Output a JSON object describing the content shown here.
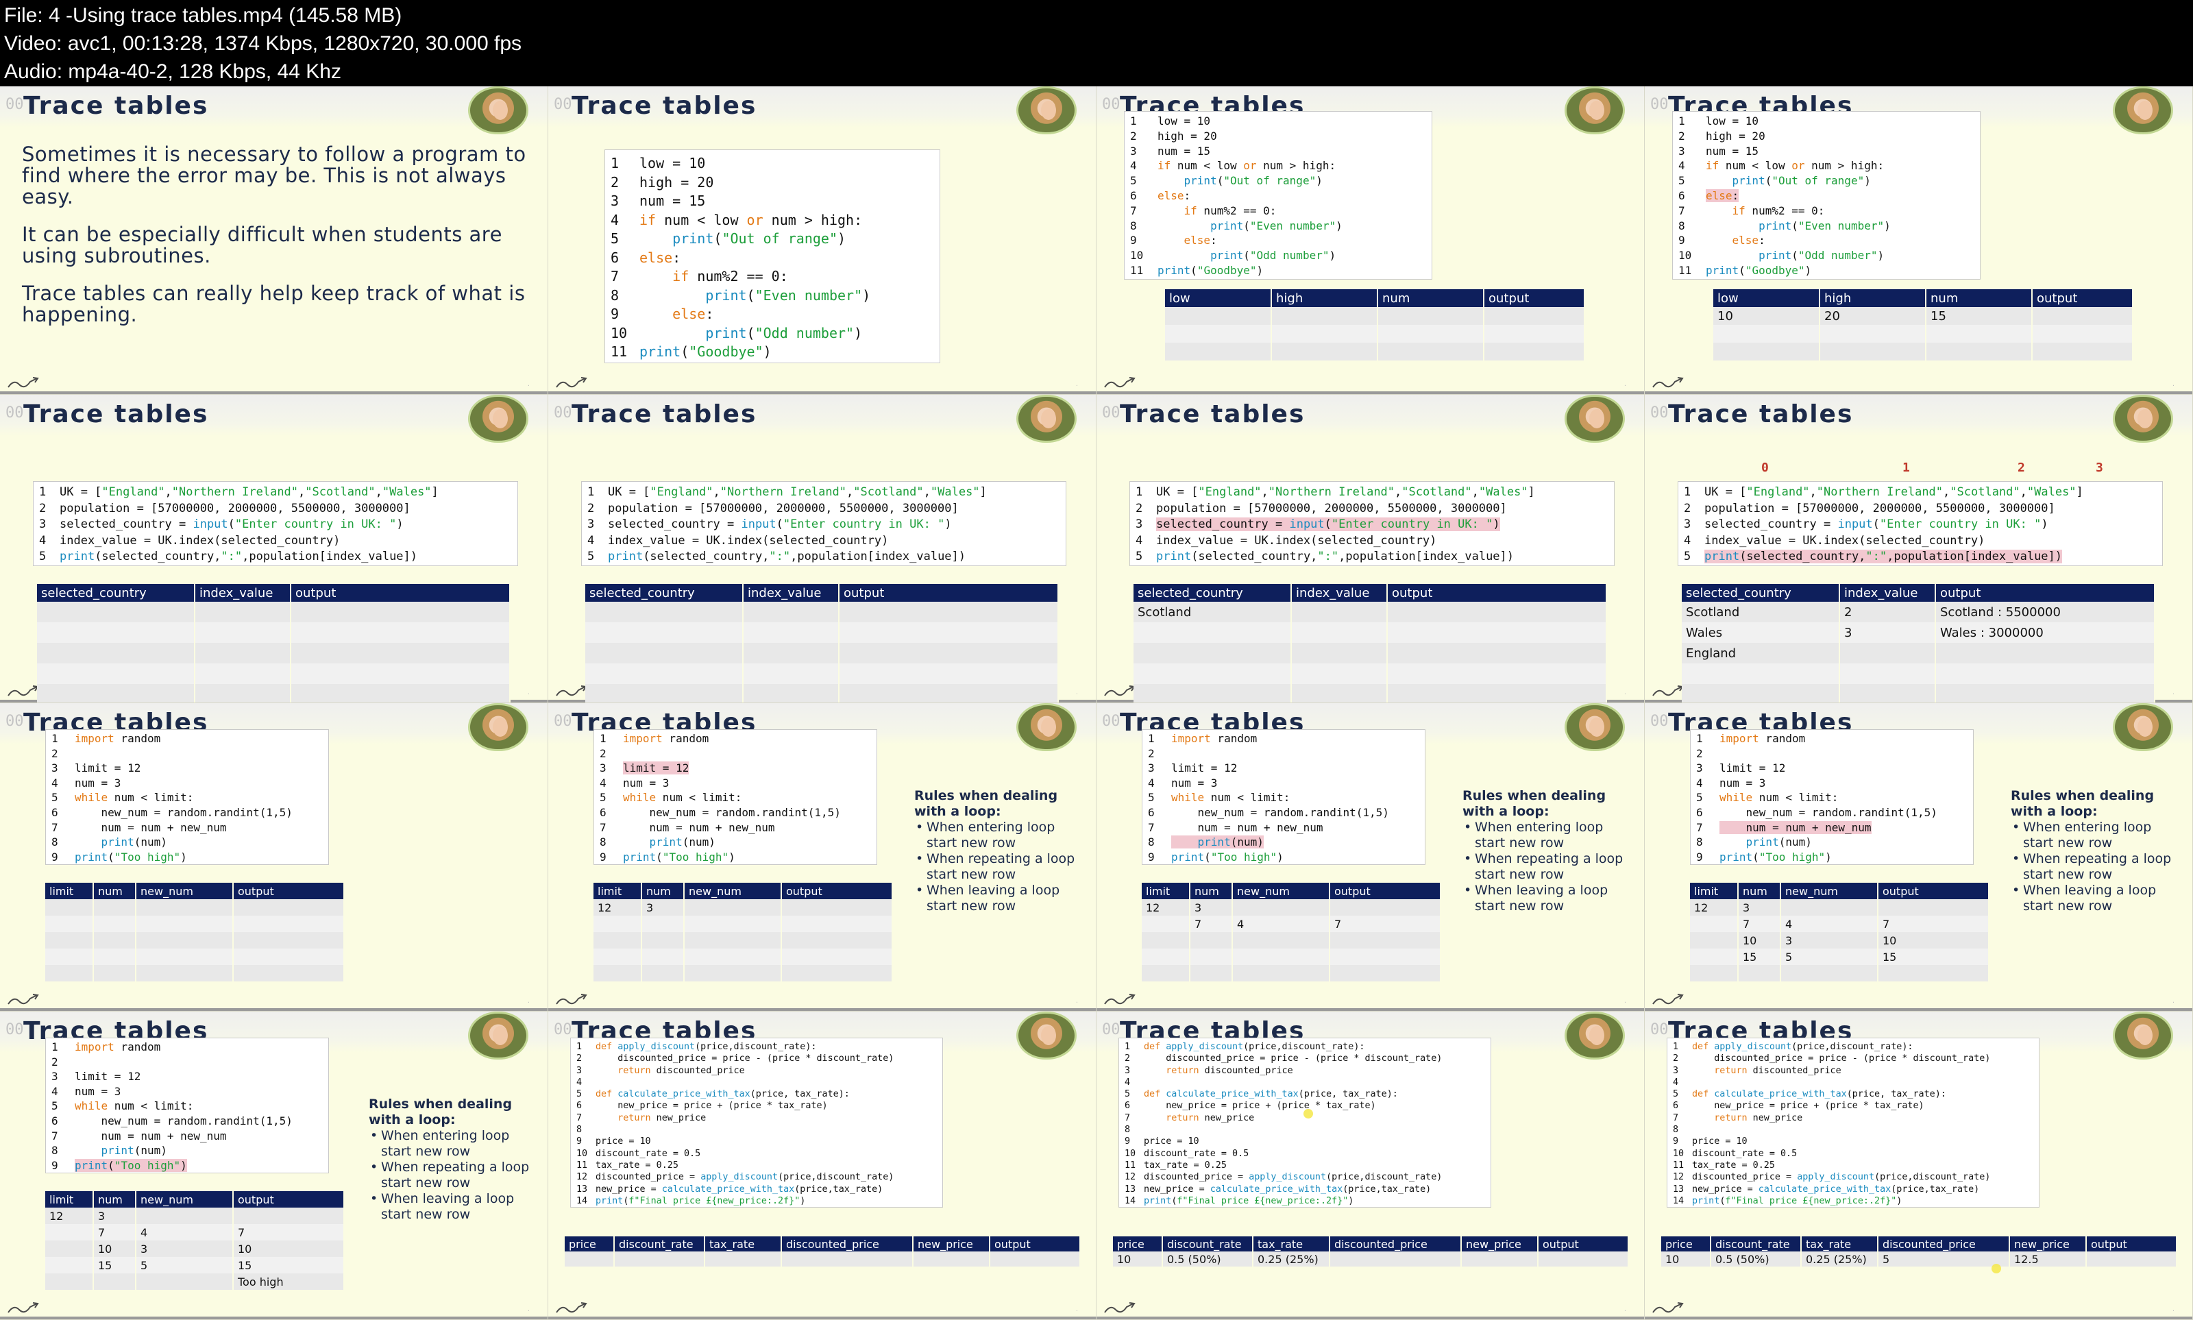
{
  "header": {
    "file_line": "File: 4 -Using trace tables.mp4 (145.58 MB)",
    "video_line": "Video: avc1, 00:13:28, 1374 Kbps, 1280x720, 30.000 fps",
    "audio_line": "Audio: mp4a-40-2, 128 Kbps, 44 Khz"
  },
  "slide_title": "Trace tables",
  "corner_timestamp": "00",
  "intro": {
    "p1": "Sometimes it is necessary to follow a program to find where the error may be. This is not always easy.",
    "p2": "It can be especially difficult when students are using subroutines.",
    "p3": "Trace tables can really help keep track of what is happening."
  },
  "code1": [
    "low = 10",
    "high = 20",
    "num = 15",
    "if num < low or num > high:",
    "    print(\"Out of range\")",
    "else:",
    "    if num%2 == 0:",
    "        print(\"Even number\")",
    "    else:",
    "        print(\"Odd number\")",
    "print(\"Goodbye\")"
  ],
  "table1": {
    "headers": [
      "low",
      "high",
      "num",
      "output"
    ],
    "filled_row": [
      "10",
      "20",
      "15",
      ""
    ]
  },
  "code2": [
    "UK = [\"England\",\"Northern Ireland\",\"Scotland\",\"Wales\"]",
    "population = [57000000, 2000000, 5500000, 3000000]",
    "selected_country = input(\"Enter country in UK: \")",
    "index_value = UK.index(selected_country)",
    "print(selected_country,\":\",population[index_value])"
  ],
  "table2": {
    "headers": [
      "selected_country",
      "index_value",
      "output"
    ],
    "partial_row": [
      "Scotland",
      "",
      ""
    ],
    "rows": [
      [
        "Scotland",
        "2",
        "Scotland : 5500000"
      ],
      [
        "Wales",
        "3",
        "Wales : 3000000"
      ],
      [
        "England",
        "",
        ""
      ]
    ]
  },
  "index_labels": [
    "0",
    "1",
    "2",
    "3"
  ],
  "code3": [
    "import random",
    "",
    "limit = 12",
    "num = 3",
    "while num < limit:",
    "    new_num = random.randint(1,5)",
    "    num = num + new_num",
    "    print(num)",
    "print(\"Too high\")"
  ],
  "table3": {
    "headers": [
      "limit",
      "num",
      "new_num",
      "output"
    ],
    "rows": [
      [
        "12",
        "3",
        "",
        ""
      ],
      [
        "",
        "7",
        "4",
        "7"
      ],
      [
        "",
        "10",
        "3",
        "10"
      ],
      [
        "",
        "15",
        "5",
        "15"
      ],
      [
        "",
        "",
        "",
        "Too high"
      ]
    ]
  },
  "rules": {
    "title": "Rules when dealing with a loop:",
    "items": [
      "When entering loop start new row",
      "When repeating a loop start new row",
      "When leaving a loop start new row"
    ]
  },
  "code4": [
    "def apply_discount(price,discount_rate):",
    "    discounted_price = price - (price * discount_rate)",
    "    return discounted_price",
    "",
    "def calculate_price_with_tax(price, tax_rate):",
    "    new_price = price + (price * tax_rate)",
    "    return new_price",
    "",
    "price = 10",
    "discount_rate = 0.5",
    "tax_rate = 0.25",
    "discounted_price = apply_discount(price,discount_rate)",
    "new_price = calculate_price_with_tax(price,tax_rate)",
    "print(f\"Final price £{new_price:.2f}\")"
  ],
  "table4": {
    "headers": [
      "price",
      "discount_rate",
      "tax_rate",
      "discounted_price",
      "new_price",
      "output"
    ],
    "row_a": [
      "10",
      "0.5 (50%)",
      "0.25 (25%)",
      "",
      "",
      ""
    ],
    "row_b": [
      "10",
      "0.5 (50%)",
      "0.25 (25%)",
      "5",
      "12.5",
      ""
    ]
  },
  "colors": {
    "table_header": "#0e1f5c",
    "slide_bg": "#fbfce2",
    "title": "#1c2a4a",
    "keyword": "#e37a16",
    "string": "#1c9e3a",
    "function": "#1a8bbf",
    "highlight": "#f2c8d0"
  }
}
